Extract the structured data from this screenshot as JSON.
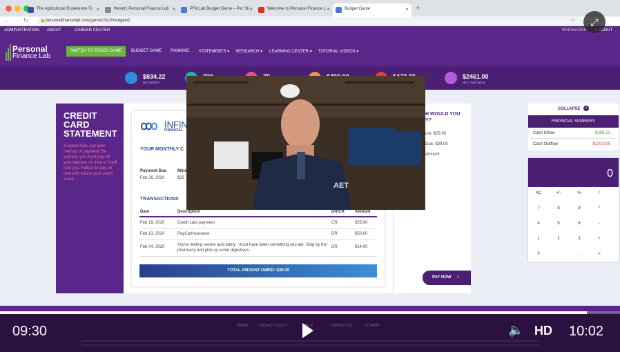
{
  "browser": {
    "tabs": [
      {
        "title": "The Agricultural Experience To",
        "icon_color": "#3b4ba8"
      },
      {
        "title": "theset | Personal Finance Lab",
        "icon_color": "#888888"
      },
      {
        "title": "PFinLab Budget Game – Per Sti",
        "icon_color": "#4a7bd6"
      },
      {
        "title": "Welcome to Personal Finance L",
        "icon_color": "#d93025"
      },
      {
        "title": "Budget Game",
        "icon_color": "#4a7bd6"
      }
    ],
    "url": "personalfinancelab.com/game101v2/budgetv2"
  },
  "topnav": {
    "admin": "ADMINISTRATION",
    "about": "ABOUT",
    "career": "CAREER CENTER",
    "user": "RHIANAGRIF",
    "logout": "LOGOUT"
  },
  "logo": {
    "line1": "Personal",
    "line2": "Finance Lab"
  },
  "mainnav": {
    "stock_button": "SWITCH TO STOCK GAME",
    "items": [
      "BUDGET GAME",
      "RANKING",
      "STATEMENTS",
      "RESEARCH",
      "LEARNING CENTER",
      "TUTORIAL VIDEOS"
    ]
  },
  "stats": [
    {
      "value": "$834.22",
      "label": "NET WORTH",
      "color": "#2f8ae0"
    },
    {
      "value": "320",
      "label": "",
      "color": "#16b6a3"
    },
    {
      "value": "70",
      "label": "",
      "color": "#e94f8a"
    },
    {
      "value": "$400.00",
      "label": "",
      "color": "#f3923b"
    },
    {
      "value": "$472.22",
      "label": "",
      "color": "#e23b3b"
    },
    {
      "value": "$2461.00",
      "label": "NEXT PAYCHECK",
      "color": "#b45be0"
    }
  ],
  "statement": {
    "title": "CREDIT CARD STATEMENT",
    "warning": "A spend now, pay later method of payment. Be warned, you must pay off your balance on time or it will cost you. Failure to pay on time will reduce your credit score.",
    "bank_name": "INFIN",
    "bank_sub": "FINANCIAL",
    "your_monthly": "YOUR MONTHLY C",
    "payment_due_label": "Payment Due",
    "payment_due_value": "Feb 26, 2020",
    "minimum_label": "Minim",
    "minimum_value": "$25",
    "transactions_title": "TRANSACTIONS",
    "columns": {
      "date": "Date",
      "description": "Description",
      "drcr": "DR/CR",
      "amount": "Amount"
    },
    "rows": [
      {
        "date": "Feb 19, 2020",
        "description": "Credit card payment",
        "drcr": "CR",
        "amount": "$25.00"
      },
      {
        "date": "Feb 13, 2020",
        "description": "PayCarInsurance",
        "drcr": "DR",
        "amount": "$50.00"
      },
      {
        "date": "Feb 04, 2020",
        "description": "You're feeling severe acid lately - must have been something you ate. Stop by the pharmacy and pick up some digestives.",
        "drcr": "DR",
        "amount": "$14.00"
      }
    ],
    "total": "TOTAL AMOUNT OWED: $39.00"
  },
  "payment_panel": {
    "question": "H WOULD YOU Y?",
    "option1": "um: $25.00",
    "option2": "Due: $39.00",
    "option3": "Amount",
    "pay_now": "PAY NOW"
  },
  "financial_summary": {
    "collapse": "COLLAPSE",
    "title": "FINANCIAL SUMMARY",
    "inflow_label": "Cash Inflow",
    "inflow_value": "$399.22",
    "outflow_label": "Cash Outflow",
    "outflow_value": "-$1010.00",
    "inflow_color": "#3aa64a",
    "outflow_color": "#e03030"
  },
  "calculator": {
    "display": "0",
    "keys": [
      [
        "AC",
        "+/-",
        "%",
        "/"
      ],
      [
        "7",
        "8",
        "9",
        "*"
      ],
      [
        "4",
        "5",
        "6",
        "-"
      ],
      [
        "1",
        "2",
        "3",
        "+"
      ],
      [
        "0",
        "",
        ".",
        "="
      ]
    ]
  },
  "footer": {
    "links": [
      "TERMS",
      "PRIVACY POLICY",
      "HELP",
      "CONTACT US",
      "SITEMAP"
    ]
  },
  "player": {
    "elapsed": "09:30",
    "remaining": "10:02",
    "quality": "HD",
    "progress_fraction": 0.946
  }
}
